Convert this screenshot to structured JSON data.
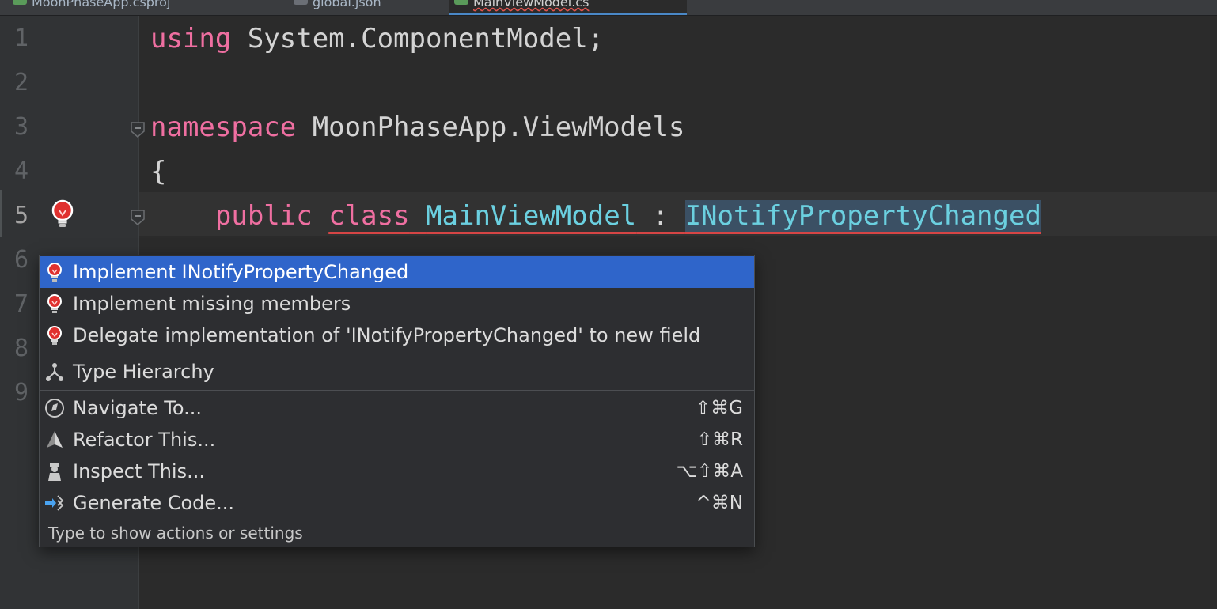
{
  "tabs": [
    {
      "label": "MoonPhaseApp.csproj"
    },
    {
      "label": "global.json"
    },
    {
      "label": "MainViewModel.cs"
    }
  ],
  "line_numbers": [
    "1",
    "2",
    "3",
    "4",
    "5",
    "6",
    "7",
    "8",
    "9"
  ],
  "code": {
    "line1_kw": "using",
    "line1_rest": " System.ComponentModel;",
    "line3_kw": "namespace",
    "line3_rest": " MoonPhaseApp.ViewModels",
    "line4": "{",
    "line5_indent": "    ",
    "line5_public": "public",
    "line5_space": " ",
    "line5_class": "class",
    "line5_name": "MainViewModel",
    "line5_colon": " : ",
    "line5_interface": "INotifyPropertyChanged"
  },
  "context_menu": {
    "items": [
      {
        "label": "Implement INotifyPropertyChanged",
        "shortcut": "",
        "icon": "bulb-icon"
      },
      {
        "label": "Implement missing members",
        "shortcut": "",
        "icon": "bulb-icon"
      },
      {
        "label": "Delegate implementation of 'INotifyPropertyChanged' to new field",
        "shortcut": "",
        "icon": "bulb-icon"
      },
      {
        "label": "Type Hierarchy",
        "shortcut": "",
        "icon": "hierarchy-icon"
      },
      {
        "label": "Navigate To...",
        "shortcut": "⇧⌘G",
        "icon": "compass-icon"
      },
      {
        "label": "Refactor This...",
        "shortcut": "⇧⌘R",
        "icon": "prism-icon"
      },
      {
        "label": "Inspect This...",
        "shortcut": "⌥⇧⌘A",
        "icon": "inspector-icon"
      },
      {
        "label": "Generate Code...",
        "shortcut": "^⌘N",
        "icon": "generate-icon"
      }
    ],
    "hint": "Type to show actions or settings"
  },
  "colors": {
    "keyword": "#ef6fa1",
    "type": "#6bd0e0",
    "selection": "#2f65ca",
    "error_underline": "#d64545"
  }
}
